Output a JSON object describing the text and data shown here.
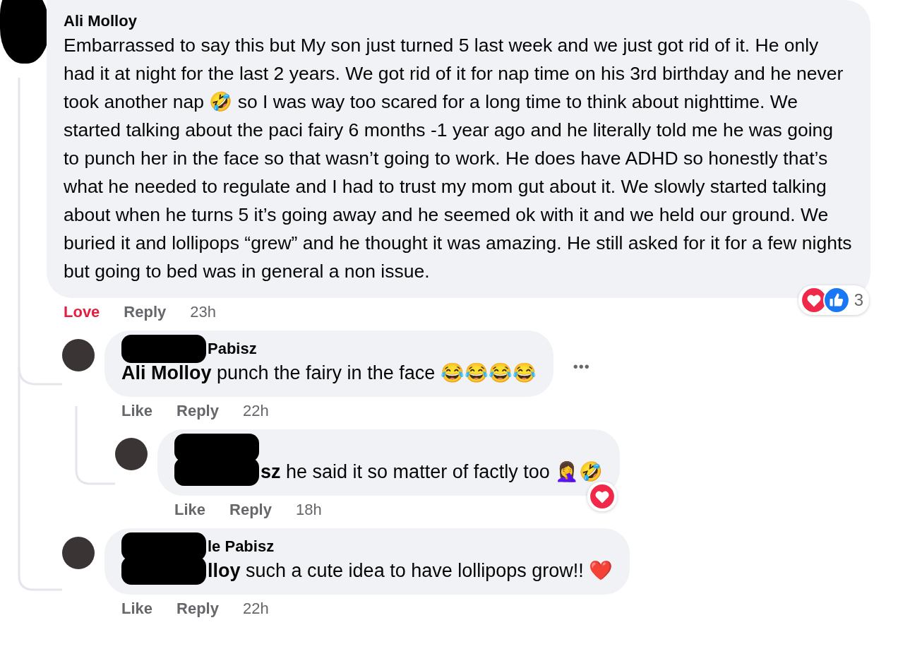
{
  "comments": [
    {
      "author": {
        "text": "Ali Molloy",
        "redacted": false
      },
      "avatar_redacted": true,
      "segments": [
        {
          "kind": "text",
          "text": "Embarrassed to say this but My son just turned 5 last week and we just got rid of it. He only had it at night for the last 2 years. We got rid of it for nap time on his 3rd birthday and he never took another nap 🤣 so I was way too scared for a long time to think about nighttime. We started talking about the paci fairy 6 months -1 year ago and he literally told me he was going to punch her in the face so that wasn’t going to work. He does have ADHD so honestly that’s what he needed to regulate and I had to trust my mom gut about it. We slowly started talking about when he turns 5 it’s going away and he seemed ok with it and we held our ground. We buried it and lollipops “grew” and he thought it was amazing. He still asked for it for a few nights but going to bed was in general a non issue."
        }
      ],
      "actions": [
        {
          "label": "Love",
          "selected": true
        },
        {
          "label": "Reply",
          "selected": false
        }
      ],
      "time": "23h",
      "reacted": true,
      "reaction_count": "3",
      "replies": [
        {
          "author": {
            "text": "Pabisz",
            "redacted": true
          },
          "avatar_redacted": false,
          "segments": [
            {
              "kind": "text",
              "text": "**Ali Molloy** punch the fairy in the face 😂😂😂😂"
            }
          ],
          "more": "•••",
          "actions": [
            {
              "label": "Like",
              "selected": false
            },
            {
              "label": "Reply",
              "selected": false
            }
          ],
          "time": "22h",
          "replies": [
            {
              "author": {
                "redacted": true
              },
              "avatar_redacted": false,
              "segments": [
                {
                  "kind": "redacted"
                },
                {
                  "kind": "text",
                  "text": "**sz** he said it so matter of factly too 🤦‍♀️🤣"
                }
              ],
              "actions": [
                {
                  "label": "Like",
                  "selected": false
                },
                {
                  "label": "Reply",
                  "selected": false
                }
              ],
              "time": "18h",
              "reacted": true
            }
          ]
        },
        {
          "author": {
            "text": "le Pabisz",
            "redacted": true
          },
          "avatar_redacted": false,
          "segments": [
            {
              "kind": "redacted"
            },
            {
              "kind": "text",
              "text": "**lloy** such a cute idea to have lollipops grow!! ❤️"
            }
          ],
          "actions": [
            {
              "label": "Like",
              "selected": false
            },
            {
              "label": "Reply",
              "selected": false
            }
          ],
          "time": "22h"
        }
      ]
    }
  ]
}
